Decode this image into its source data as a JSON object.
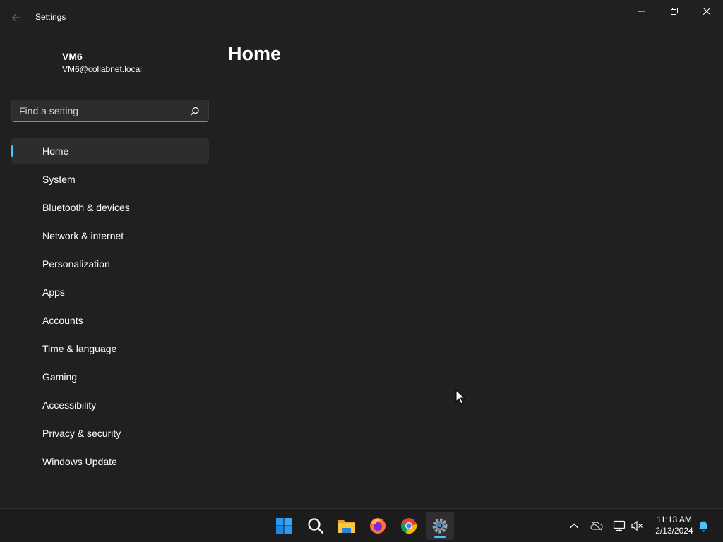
{
  "window": {
    "title": "Settings"
  },
  "profile": {
    "name": "VM6",
    "email": "VM6@collabnet.local"
  },
  "search": {
    "placeholder": "Find a setting",
    "value": ""
  },
  "nav": {
    "items": [
      {
        "label": "Home",
        "active": true
      },
      {
        "label": "System"
      },
      {
        "label": "Bluetooth & devices"
      },
      {
        "label": "Network & internet"
      },
      {
        "label": "Personalization"
      },
      {
        "label": "Apps"
      },
      {
        "label": "Accounts"
      },
      {
        "label": "Time & language"
      },
      {
        "label": "Gaming"
      },
      {
        "label": "Accessibility"
      },
      {
        "label": "Privacy & security"
      },
      {
        "label": "Windows Update"
      }
    ]
  },
  "main": {
    "page_title": "Home"
  },
  "taskbar": {
    "apps": [
      "windows-start-icon",
      "search-icon",
      "file-explorer-icon",
      "firefox-icon",
      "chrome-icon",
      "settings-icon"
    ],
    "tray_icons": [
      "chevron-up-icon",
      "onedrive-icon",
      "network-icon",
      "volume-muted-icon",
      "notification-bell-icon"
    ],
    "clock": {
      "time": "11:13 AM",
      "date": "2/13/2024"
    }
  },
  "colors": {
    "background": "#202020",
    "accent": "#4cc2ff",
    "nav_active": "#2d2d2d",
    "taskbar": "#1c1c1c"
  }
}
